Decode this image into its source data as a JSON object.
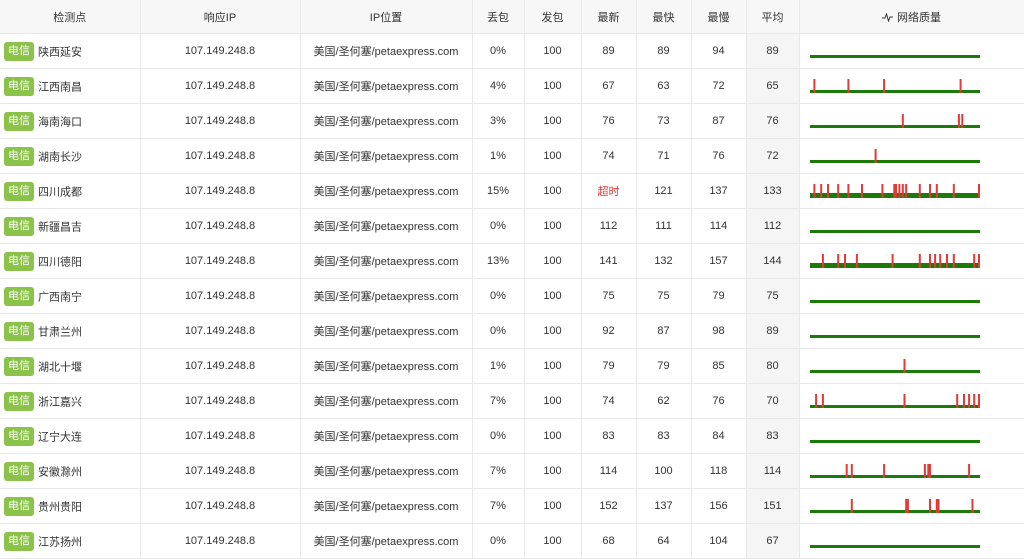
{
  "headers": {
    "node": "检测点",
    "ip": "响应IP",
    "location": "IP位置",
    "loss": "丢包",
    "sent": "发包",
    "latest": "最新",
    "fastest": "最快",
    "slowest": "最慢",
    "average": "平均",
    "quality": "网络质量"
  },
  "colors": {
    "isp_badge": "#8bc34a",
    "quality_bar": "#1b7a0a",
    "quality_spike": "#e53935",
    "timeout_text": "#e53935"
  },
  "rows": [
    {
      "isp": "电信",
      "city": "陕西延安",
      "ip": "107.149.248.8",
      "location": "美国/圣何塞/petaexpress.com",
      "loss": "0%",
      "sent": "100",
      "latest": "89",
      "fastest": "89",
      "slowest": "94",
      "average": "89",
      "spikes": []
    },
    {
      "isp": "电信",
      "city": "江西南昌",
      "ip": "107.149.248.8",
      "location": "美国/圣何塞/petaexpress.com",
      "loss": "4%",
      "sent": "100",
      "latest": "67",
      "fastest": "63",
      "slowest": "72",
      "average": "65",
      "spikes": [
        0.02,
        0.22,
        0.43,
        0.88
      ]
    },
    {
      "isp": "电信",
      "city": "海南海口",
      "ip": "107.149.248.8",
      "location": "美国/圣何塞/petaexpress.com",
      "loss": "3%",
      "sent": "100",
      "latest": "76",
      "fastest": "73",
      "slowest": "87",
      "average": "76",
      "spikes": [
        0.54,
        0.87,
        0.89
      ]
    },
    {
      "isp": "电信",
      "city": "湖南长沙",
      "ip": "107.149.248.8",
      "location": "美国/圣何塞/petaexpress.com",
      "loss": "1%",
      "sent": "100",
      "latest": "74",
      "fastest": "71",
      "slowest": "76",
      "average": "72",
      "spikes": [
        0.38
      ]
    },
    {
      "isp": "电信",
      "city": "四川成都",
      "ip": "107.149.248.8",
      "location": "美国/圣何塞/petaexpress.com",
      "loss": "15%",
      "sent": "100",
      "latest": "超时",
      "fastest": "121",
      "slowest": "137",
      "average": "133",
      "spikes": [
        0.02,
        0.06,
        0.1,
        0.16,
        0.22,
        0.3,
        0.42,
        0.49,
        0.5,
        0.52,
        0.54,
        0.56,
        0.64,
        0.7,
        0.74,
        0.84,
        0.99
      ]
    },
    {
      "isp": "电信",
      "city": "新疆昌吉",
      "ip": "107.149.248.8",
      "location": "美国/圣何塞/petaexpress.com",
      "loss": "0%",
      "sent": "100",
      "latest": "112",
      "fastest": "111",
      "slowest": "114",
      "average": "112",
      "spikes": []
    },
    {
      "isp": "电信",
      "city": "四川德阳",
      "ip": "107.149.248.8",
      "location": "美国/圣何塞/petaexpress.com",
      "loss": "13%",
      "sent": "100",
      "latest": "141",
      "fastest": "132",
      "slowest": "157",
      "average": "144",
      "spikes": [
        0.07,
        0.16,
        0.2,
        0.27,
        0.48,
        0.64,
        0.7,
        0.73,
        0.76,
        0.8,
        0.84,
        0.96,
        0.99
      ]
    },
    {
      "isp": "电信",
      "city": "广西南宁",
      "ip": "107.149.248.8",
      "location": "美国/圣何塞/petaexpress.com",
      "loss": "0%",
      "sent": "100",
      "latest": "75",
      "fastest": "75",
      "slowest": "79",
      "average": "75",
      "spikes": []
    },
    {
      "isp": "电信",
      "city": "甘肃兰州",
      "ip": "107.149.248.8",
      "location": "美国/圣何塞/petaexpress.com",
      "loss": "0%",
      "sent": "100",
      "latest": "92",
      "fastest": "87",
      "slowest": "98",
      "average": "89",
      "spikes": []
    },
    {
      "isp": "电信",
      "city": "湖北十堰",
      "ip": "107.149.248.8",
      "location": "美国/圣何塞/petaexpress.com",
      "loss": "1%",
      "sent": "100",
      "latest": "79",
      "fastest": "79",
      "slowest": "85",
      "average": "80",
      "spikes": [
        0.55
      ]
    },
    {
      "isp": "电信",
      "city": "浙江嘉兴",
      "ip": "107.149.248.8",
      "location": "美国/圣何塞/petaexpress.com",
      "loss": "7%",
      "sent": "100",
      "latest": "74",
      "fastest": "62",
      "slowest": "76",
      "average": "70",
      "spikes": [
        0.03,
        0.07,
        0.55,
        0.86,
        0.9,
        0.93,
        0.96,
        0.99
      ]
    },
    {
      "isp": "电信",
      "city": "辽宁大连",
      "ip": "107.149.248.8",
      "location": "美国/圣何塞/petaexpress.com",
      "loss": "0%",
      "sent": "100",
      "latest": "83",
      "fastest": "83",
      "slowest": "84",
      "average": "83",
      "spikes": []
    },
    {
      "isp": "电信",
      "city": "安徽滁州",
      "ip": "107.149.248.8",
      "location": "美国/圣何塞/petaexpress.com",
      "loss": "7%",
      "sent": "100",
      "latest": "114",
      "fastest": "100",
      "slowest": "118",
      "average": "114",
      "spikes": [
        0.21,
        0.24,
        0.43,
        0.67,
        0.69,
        0.7,
        0.93
      ]
    },
    {
      "isp": "电信",
      "city": "贵州贵阳",
      "ip": "107.149.248.8",
      "location": "美国/圣何塞/petaexpress.com",
      "loss": "7%",
      "sent": "100",
      "latest": "152",
      "fastest": "137",
      "slowest": "156",
      "average": "151",
      "spikes": [
        0.24,
        0.56,
        0.57,
        0.7,
        0.74,
        0.75,
        0.95
      ]
    },
    {
      "isp": "电信",
      "city": "江苏扬州",
      "ip": "107.149.248.8",
      "location": "美国/圣何塞/petaexpress.com",
      "loss": "0%",
      "sent": "100",
      "latest": "68",
      "fastest": "64",
      "slowest": "104",
      "average": "67",
      "spikes": []
    }
  ]
}
